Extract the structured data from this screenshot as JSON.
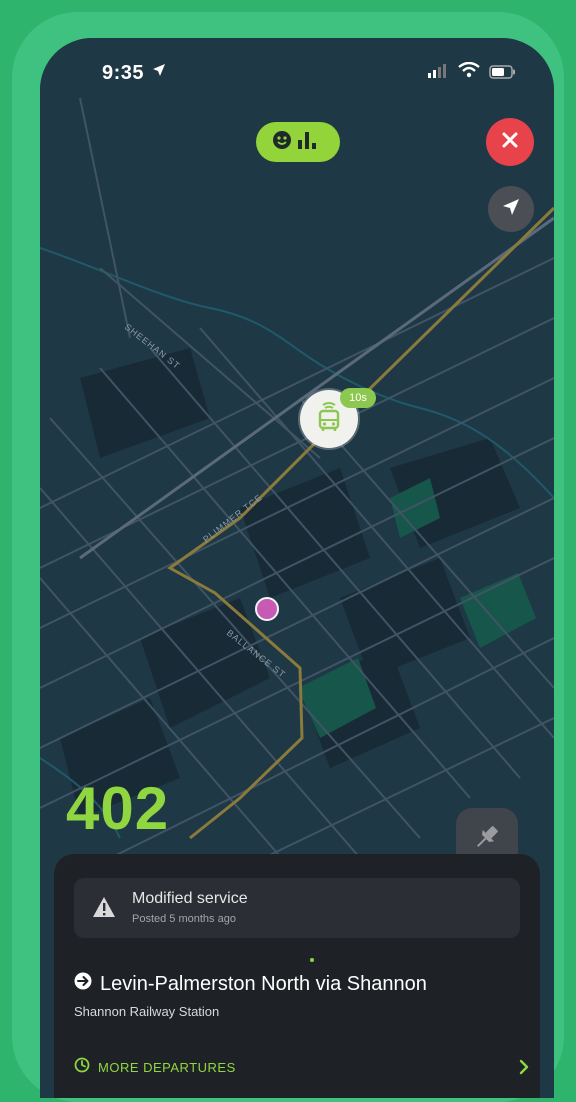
{
  "status_bar": {
    "time": "9:35",
    "icons": [
      "location-arrow-icon",
      "signal-icon",
      "wifi-icon",
      "battery-icon"
    ]
  },
  "top_controls": {
    "crowding_icon": "smiley-bars-icon",
    "close_icon": "close-icon",
    "locate_icon": "navigation-arrow-icon"
  },
  "map": {
    "street_labels": [
      "SHEEHAN ST",
      "PLIMMER TCE",
      "BALLANCE ST"
    ],
    "vehicle": {
      "icon": "bus-icon",
      "eta": "10s"
    },
    "route_line_color": "#8a7a3c"
  },
  "route_number": "402",
  "pin_icon": "pushpin-icon",
  "sheet": {
    "alert": {
      "icon": "warning-icon",
      "title": "Modified service",
      "subtitle": "Posted 5 months ago"
    },
    "route": {
      "icon": "arrow-circle-icon",
      "title": "Levin-Palmerston North via Shannon",
      "stop": "Shannon Railway Station"
    },
    "more_departures": {
      "icon": "clock-icon",
      "label": "MORE DEPARTURES",
      "chevron": "chevron-right-icon"
    }
  },
  "colors": {
    "accent": "#8fd640",
    "background_green": "#2fb46e",
    "close_red": "#e8434b",
    "stop_dot": "#c65ab5"
  }
}
